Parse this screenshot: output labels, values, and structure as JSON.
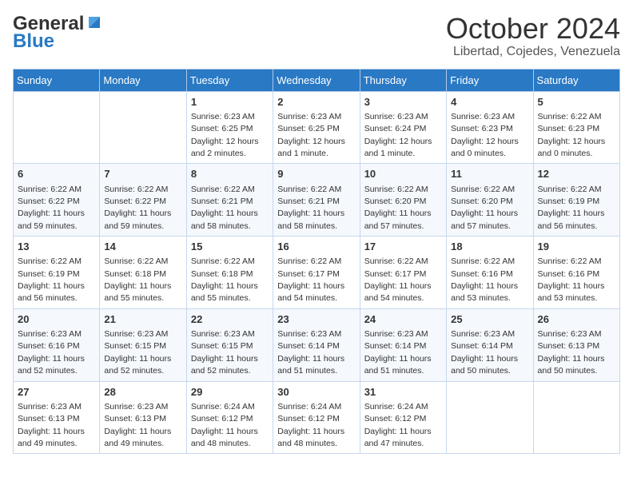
{
  "header": {
    "logo_line1": "General",
    "logo_line2": "Blue",
    "title": "October 2024",
    "subtitle": "Libertad, Cojedes, Venezuela"
  },
  "calendar": {
    "days_of_week": [
      "Sunday",
      "Monday",
      "Tuesday",
      "Wednesday",
      "Thursday",
      "Friday",
      "Saturday"
    ],
    "weeks": [
      [
        {
          "day": null,
          "info": null
        },
        {
          "day": null,
          "info": null
        },
        {
          "day": "1",
          "info": "Sunrise: 6:23 AM\nSunset: 6:25 PM\nDaylight: 12 hours\nand 2 minutes."
        },
        {
          "day": "2",
          "info": "Sunrise: 6:23 AM\nSunset: 6:25 PM\nDaylight: 12 hours\nand 1 minute."
        },
        {
          "day": "3",
          "info": "Sunrise: 6:23 AM\nSunset: 6:24 PM\nDaylight: 12 hours\nand 1 minute."
        },
        {
          "day": "4",
          "info": "Sunrise: 6:23 AM\nSunset: 6:23 PM\nDaylight: 12 hours\nand 0 minutes."
        },
        {
          "day": "5",
          "info": "Sunrise: 6:22 AM\nSunset: 6:23 PM\nDaylight: 12 hours\nand 0 minutes."
        }
      ],
      [
        {
          "day": "6",
          "info": "Sunrise: 6:22 AM\nSunset: 6:22 PM\nDaylight: 11 hours\nand 59 minutes."
        },
        {
          "day": "7",
          "info": "Sunrise: 6:22 AM\nSunset: 6:22 PM\nDaylight: 11 hours\nand 59 minutes."
        },
        {
          "day": "8",
          "info": "Sunrise: 6:22 AM\nSunset: 6:21 PM\nDaylight: 11 hours\nand 58 minutes."
        },
        {
          "day": "9",
          "info": "Sunrise: 6:22 AM\nSunset: 6:21 PM\nDaylight: 11 hours\nand 58 minutes."
        },
        {
          "day": "10",
          "info": "Sunrise: 6:22 AM\nSunset: 6:20 PM\nDaylight: 11 hours\nand 57 minutes."
        },
        {
          "day": "11",
          "info": "Sunrise: 6:22 AM\nSunset: 6:20 PM\nDaylight: 11 hours\nand 57 minutes."
        },
        {
          "day": "12",
          "info": "Sunrise: 6:22 AM\nSunset: 6:19 PM\nDaylight: 11 hours\nand 56 minutes."
        }
      ],
      [
        {
          "day": "13",
          "info": "Sunrise: 6:22 AM\nSunset: 6:19 PM\nDaylight: 11 hours\nand 56 minutes."
        },
        {
          "day": "14",
          "info": "Sunrise: 6:22 AM\nSunset: 6:18 PM\nDaylight: 11 hours\nand 55 minutes."
        },
        {
          "day": "15",
          "info": "Sunrise: 6:22 AM\nSunset: 6:18 PM\nDaylight: 11 hours\nand 55 minutes."
        },
        {
          "day": "16",
          "info": "Sunrise: 6:22 AM\nSunset: 6:17 PM\nDaylight: 11 hours\nand 54 minutes."
        },
        {
          "day": "17",
          "info": "Sunrise: 6:22 AM\nSunset: 6:17 PM\nDaylight: 11 hours\nand 54 minutes."
        },
        {
          "day": "18",
          "info": "Sunrise: 6:22 AM\nSunset: 6:16 PM\nDaylight: 11 hours\nand 53 minutes."
        },
        {
          "day": "19",
          "info": "Sunrise: 6:22 AM\nSunset: 6:16 PM\nDaylight: 11 hours\nand 53 minutes."
        }
      ],
      [
        {
          "day": "20",
          "info": "Sunrise: 6:23 AM\nSunset: 6:16 PM\nDaylight: 11 hours\nand 52 minutes."
        },
        {
          "day": "21",
          "info": "Sunrise: 6:23 AM\nSunset: 6:15 PM\nDaylight: 11 hours\nand 52 minutes."
        },
        {
          "day": "22",
          "info": "Sunrise: 6:23 AM\nSunset: 6:15 PM\nDaylight: 11 hours\nand 52 minutes."
        },
        {
          "day": "23",
          "info": "Sunrise: 6:23 AM\nSunset: 6:14 PM\nDaylight: 11 hours\nand 51 minutes."
        },
        {
          "day": "24",
          "info": "Sunrise: 6:23 AM\nSunset: 6:14 PM\nDaylight: 11 hours\nand 51 minutes."
        },
        {
          "day": "25",
          "info": "Sunrise: 6:23 AM\nSunset: 6:14 PM\nDaylight: 11 hours\nand 50 minutes."
        },
        {
          "day": "26",
          "info": "Sunrise: 6:23 AM\nSunset: 6:13 PM\nDaylight: 11 hours\nand 50 minutes."
        }
      ],
      [
        {
          "day": "27",
          "info": "Sunrise: 6:23 AM\nSunset: 6:13 PM\nDaylight: 11 hours\nand 49 minutes."
        },
        {
          "day": "28",
          "info": "Sunrise: 6:23 AM\nSunset: 6:13 PM\nDaylight: 11 hours\nand 49 minutes."
        },
        {
          "day": "29",
          "info": "Sunrise: 6:24 AM\nSunset: 6:12 PM\nDaylight: 11 hours\nand 48 minutes."
        },
        {
          "day": "30",
          "info": "Sunrise: 6:24 AM\nSunset: 6:12 PM\nDaylight: 11 hours\nand 48 minutes."
        },
        {
          "day": "31",
          "info": "Sunrise: 6:24 AM\nSunset: 6:12 PM\nDaylight: 11 hours\nand 47 minutes."
        },
        {
          "day": null,
          "info": null
        },
        {
          "day": null,
          "info": null
        }
      ]
    ]
  }
}
